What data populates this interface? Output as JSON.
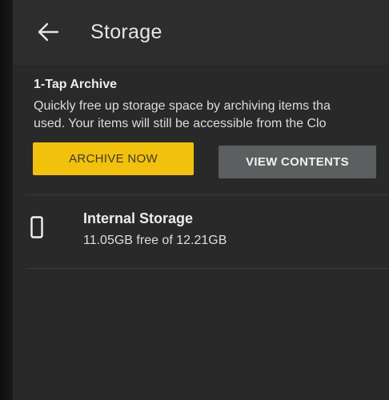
{
  "header": {
    "title": "Storage",
    "back_icon": "arrow-left-icon"
  },
  "archive": {
    "heading": "1-Tap Archive",
    "description_line1": "Quickly free up storage space by archiving items tha",
    "description_line2": "used. Your items will still be accessible from the Clo",
    "archive_button_label": "ARCHIVE NOW",
    "view_button_label": "VIEW CONTENTS"
  },
  "storage_items": [
    {
      "title": "Internal Storage",
      "subtitle": "11.05GB free of 12.21GB",
      "icon": "tablet-device-icon"
    }
  ],
  "colors": {
    "background": "#2a2929",
    "accent_yellow": "#f2c10e",
    "secondary_button": "#5b5f5f",
    "text": "#e8e8e8"
  }
}
